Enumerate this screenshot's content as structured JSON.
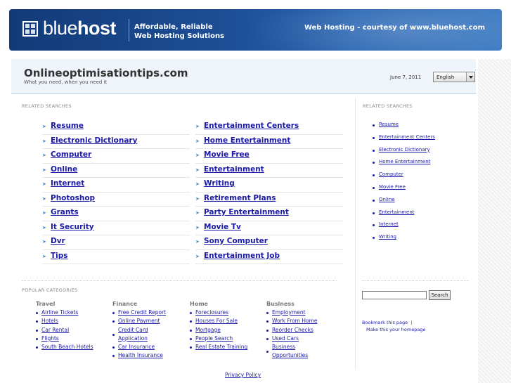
{
  "banner": {
    "logo_light": "blue",
    "logo_bold": "host",
    "tagline_line1": "Affordable, Reliable",
    "tagline_line2": "Web Hosting Solutions",
    "courtesy": "Web Hosting - courtesy of www.bluehost.com"
  },
  "header": {
    "title": "Onlineoptimisationtips.com",
    "subtitle": "What you need, when you need it",
    "date": "June 7, 2011",
    "language": "English"
  },
  "main": {
    "label": "RELATED SEARCHES",
    "left_items": [
      "Resume",
      "Electronic Dictionary",
      "Computer",
      "Online",
      "Internet",
      "Photoshop",
      "Grants",
      "It Security",
      "Dvr",
      "Tips"
    ],
    "right_items": [
      "Entertainment Centers",
      "Home Entertainment",
      "Movie Free",
      "Entertainment",
      "Writing",
      "Retirement Plans",
      "Party Entertainment",
      "Movie Tv",
      "Sony Computer",
      "Entertainment Job"
    ]
  },
  "sidebar": {
    "label": "RELATED SEARCHES",
    "items": [
      "Resume",
      "Entertainment Centers",
      "Electronic Dictionary",
      "Home Entertainment",
      "Computer",
      "Movie Free",
      "Online",
      "Entertainment",
      "Internet",
      "Writing"
    ],
    "search_button": "Search",
    "bookmark": "Bookmark this page",
    "separator": "|",
    "homepage": "Make this your homepage"
  },
  "popular": {
    "label": "POPULAR CATEGORIES",
    "travel": {
      "title": "Travel",
      "items": [
        "Airline Tickets",
        "Hotels",
        "Car Rental",
        "Flights",
        "South Beach Hotels"
      ]
    },
    "finance": {
      "title": "Finance",
      "items": [
        "Free Credit Report",
        "Online Payment",
        "Credit Card Application",
        "Car Insurance",
        "Health Insurance"
      ]
    },
    "home": {
      "title": "Home",
      "items": [
        "Foreclosures",
        "Houses For Sale",
        "Mortgage",
        "People Search",
        "Real Estate Training"
      ]
    },
    "business": {
      "title": "Business",
      "items": [
        "Employment",
        "Work From Home",
        "Reorder Checks",
        "Used Cars",
        "Business Opportunities"
      ]
    }
  },
  "footer": {
    "privacy": "Privacy Policy"
  },
  "colors": {
    "link": "#1a1aa6",
    "banner": "#1d4f97",
    "header_bg": "#eef4fa"
  }
}
